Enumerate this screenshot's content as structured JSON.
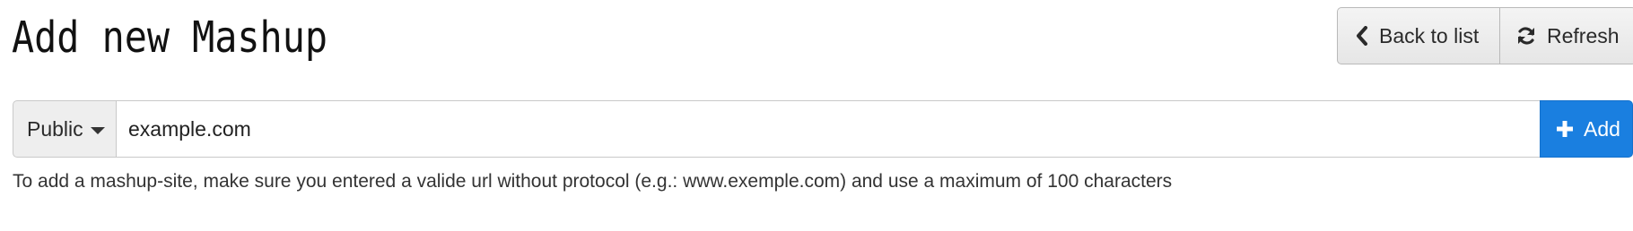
{
  "header": {
    "title": "Add new Mashup",
    "back_icon": "chevron-left-icon",
    "back_label": "Back to list",
    "refresh_icon": "refresh-icon",
    "refresh_label": "Refresh"
  },
  "form": {
    "visibility_label": "Public",
    "url_value": "example.com",
    "add_icon": "plus-icon",
    "add_label": "Add",
    "help_text": "To add a mashup-site, make sure you entered a valide url without protocol (e.g.: www.exemple.com) and use a maximum of 100 characters"
  },
  "colors": {
    "primary": "#1a7fe0",
    "button_default": "#eeeeee",
    "text": "#333333"
  }
}
